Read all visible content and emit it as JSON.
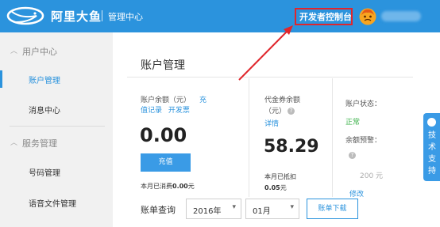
{
  "header": {
    "brand": "阿里大鱼",
    "subtitle": "管理中心",
    "dev_console": "开发者控制台",
    "logo_icon": "fish-logo-icon",
    "avatar_icon": "avatar-face-icon",
    "bg_color": "#2b93dd",
    "highlight_color": "#e0262c"
  },
  "sidebar": {
    "groups": [
      {
        "label": "用户中心",
        "icon": "chevron-up-icon",
        "items": [
          {
            "label": "账户管理",
            "active": true
          },
          {
            "label": "消息中心"
          }
        ]
      },
      {
        "label": "服务管理",
        "icon": "chevron-up-icon",
        "items": [
          {
            "label": "号码管理"
          },
          {
            "label": "语音文件管理"
          }
        ]
      }
    ]
  },
  "main": {
    "title": "账户管理",
    "balance": {
      "label": "账户余额（元）",
      "recharge_record_part1": "充",
      "recharge_record_part2": "值记录",
      "invoice": "开发票",
      "amount": "0.00",
      "recharge_button": "充值",
      "spent_prefix": "本月已消费",
      "spent_value": "0.00",
      "spent_suffix": "元"
    },
    "voucher": {
      "label_line1": "代金券余额",
      "label_line2": "（元）",
      "help_icon": "question-circle-icon",
      "detail_link": "详情",
      "amount": "58.29",
      "used_line1": "本月已抵扣",
      "used_value": "0.05",
      "used_suffix": "元"
    },
    "account": {
      "status_label": "账户状态：",
      "status_value": "正常",
      "status_color": "#3bb24a",
      "alert_label": "余额预警：",
      "alert_help_icon": "question-circle-icon",
      "alert_value": "200 元",
      "modify_link": "修改"
    },
    "bill_query": {
      "label": "账单查询",
      "year": "2016年",
      "month": "01月",
      "download_button": "账单下载"
    }
  },
  "support_tab": {
    "label": "技术支持",
    "icon": "support-icon"
  }
}
